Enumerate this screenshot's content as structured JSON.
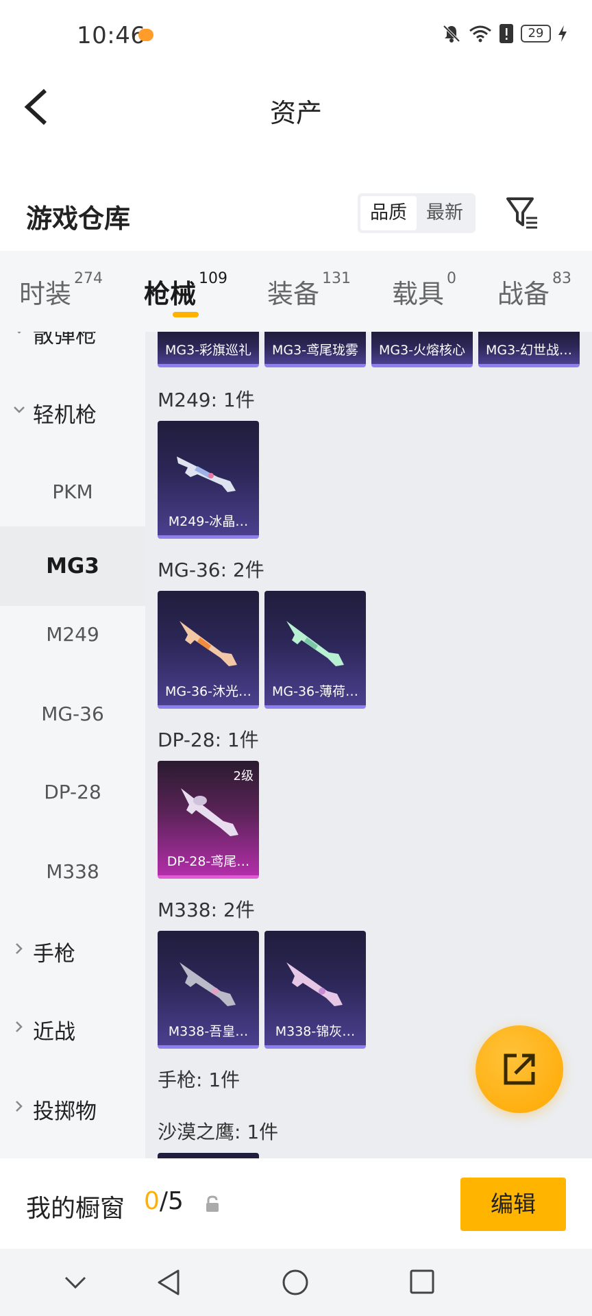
{
  "status_bar": {
    "time": "10:46",
    "battery": "29"
  },
  "header": {
    "title": "资产"
  },
  "warehouse": {
    "title": "游戏仓库",
    "sort_options": [
      "品质",
      "最新"
    ]
  },
  "tabs": [
    {
      "label": "时装",
      "count": "274"
    },
    {
      "label": "枪械",
      "count": "109"
    },
    {
      "label": "装备",
      "count": "131"
    },
    {
      "label": "载具",
      "count": "0"
    },
    {
      "label": "战备",
      "count": "83"
    }
  ],
  "sidebar": {
    "partial_top": "散弹枪",
    "category_expanded": "轻机枪",
    "items": [
      "PKM",
      "MG3",
      "M249",
      "MG-36",
      "DP-28",
      "M338"
    ],
    "categories_collapsed": [
      "手枪",
      "近战",
      "投掷物"
    ]
  },
  "content": {
    "top_cards": [
      "MG3-彩旗巡礼",
      "MG3-鸢尾珑雾",
      "MG3-火熔核心",
      "MG3-幻世战…"
    ],
    "sections": [
      {
        "title": "M249: 1件",
        "cards": [
          {
            "label": "M249-冰晶…"
          }
        ]
      },
      {
        "title": "MG-36: 2件",
        "cards": [
          {
            "label": "MG-36-沐光…"
          },
          {
            "label": "MG-36-薄荷…"
          }
        ]
      },
      {
        "title": "DP-28: 1件",
        "cards": [
          {
            "label": "DP-28-鸢尾…",
            "level": "2级"
          }
        ]
      },
      {
        "title": "M338: 2件",
        "cards": [
          {
            "label": "M338-吾皇…"
          },
          {
            "label": "M338-锦灰…"
          }
        ]
      }
    ],
    "subsections": [
      "手枪: 1件",
      "沙漠之鹰: 1件"
    ]
  },
  "showcase": {
    "label": "我的橱窗",
    "current": "0",
    "total": "/5",
    "edit_label": "编辑"
  },
  "colors": {
    "accent": "#ffb400",
    "card_purple": "#4b3f8e",
    "card_magenta": "#b22ea9"
  }
}
